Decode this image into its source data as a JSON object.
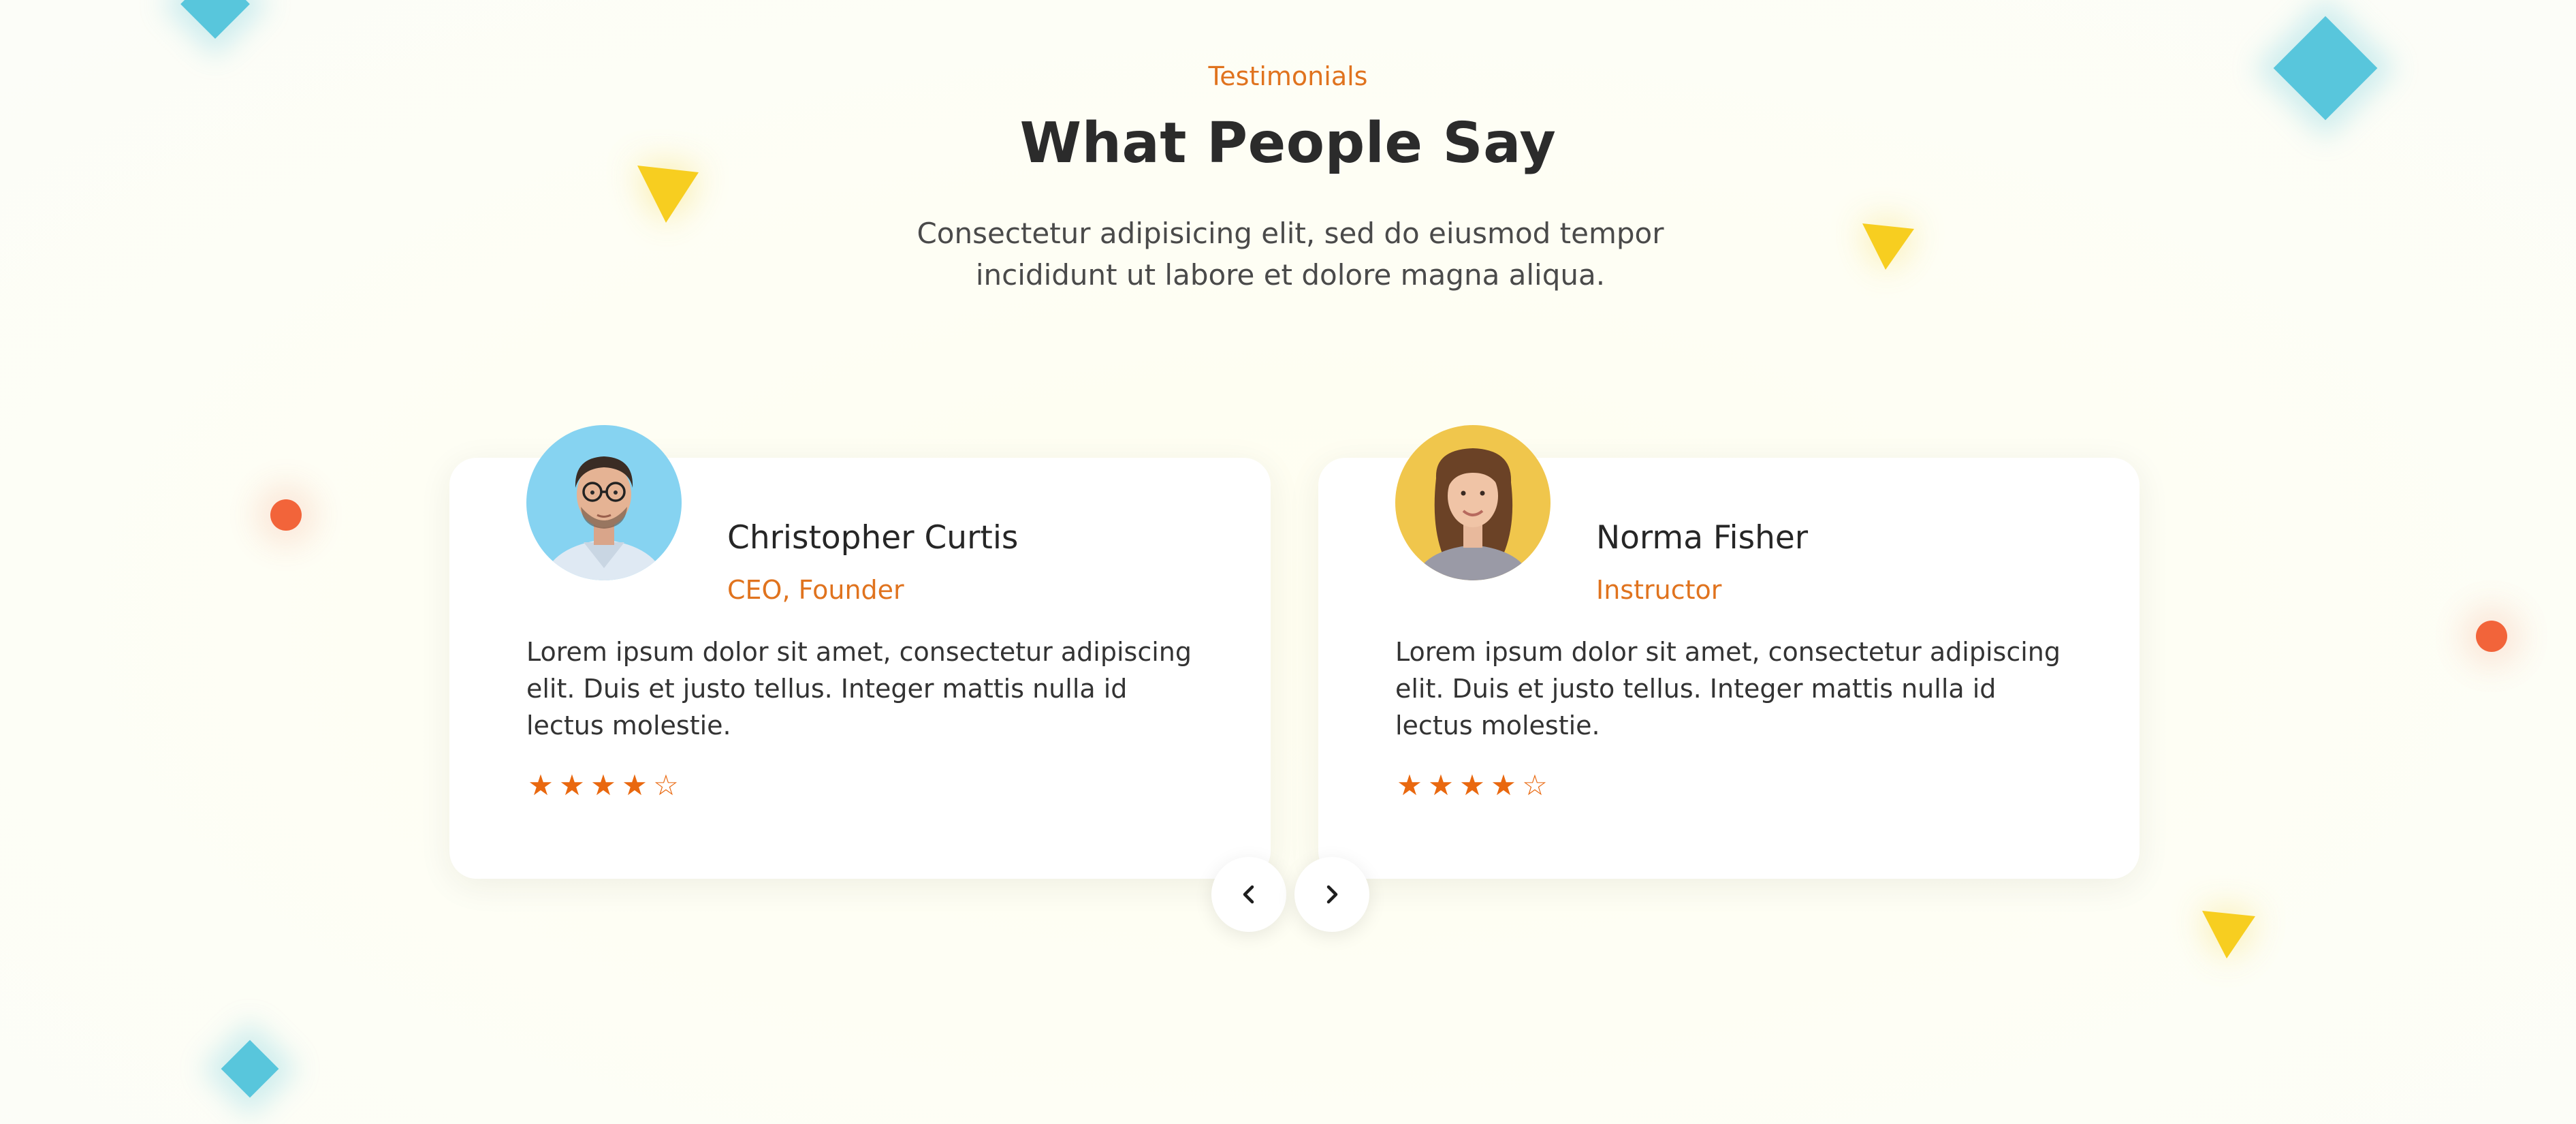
{
  "section": {
    "eyebrow": "Testimonials",
    "title": "What People Say",
    "subtitle_line1": "Consectetur adipisicing elit, sed do eiusmod tempor",
    "subtitle_line2": "incididunt ut labore et dolore magna aliqua."
  },
  "testimonials": [
    {
      "name": "Christopher Curtis",
      "role": "CEO, Founder",
      "quote": "Lorem ipsum dolor sit amet, consectetur adipiscing elit. Duis et justo tellus. Integer mattis nulla id lectus molestie.",
      "rating": 4,
      "rating_max": 5,
      "avatar_bg": "#86d3f1"
    },
    {
      "name": "Norma Fisher",
      "role": "Instructor",
      "quote": "Lorem ipsum dolor sit amet, consectetur adipiscing elit. Duis et justo tellus. Integer mattis nulla id lectus molestie.",
      "rating": 4,
      "rating_max": 5,
      "avatar_bg": "#f0c64c"
    }
  ],
  "carousel": {
    "prev_icon": "chevron-left-icon",
    "next_icon": "chevron-right-icon"
  },
  "icons": {
    "star_filled": "★",
    "star_empty": "☆"
  },
  "colors": {
    "accent_orange": "#e0731e",
    "star_orange": "#e9680f",
    "deco_blue": "#58c6dc",
    "deco_yellow": "#f7ce20",
    "deco_red": "#f2643a"
  }
}
